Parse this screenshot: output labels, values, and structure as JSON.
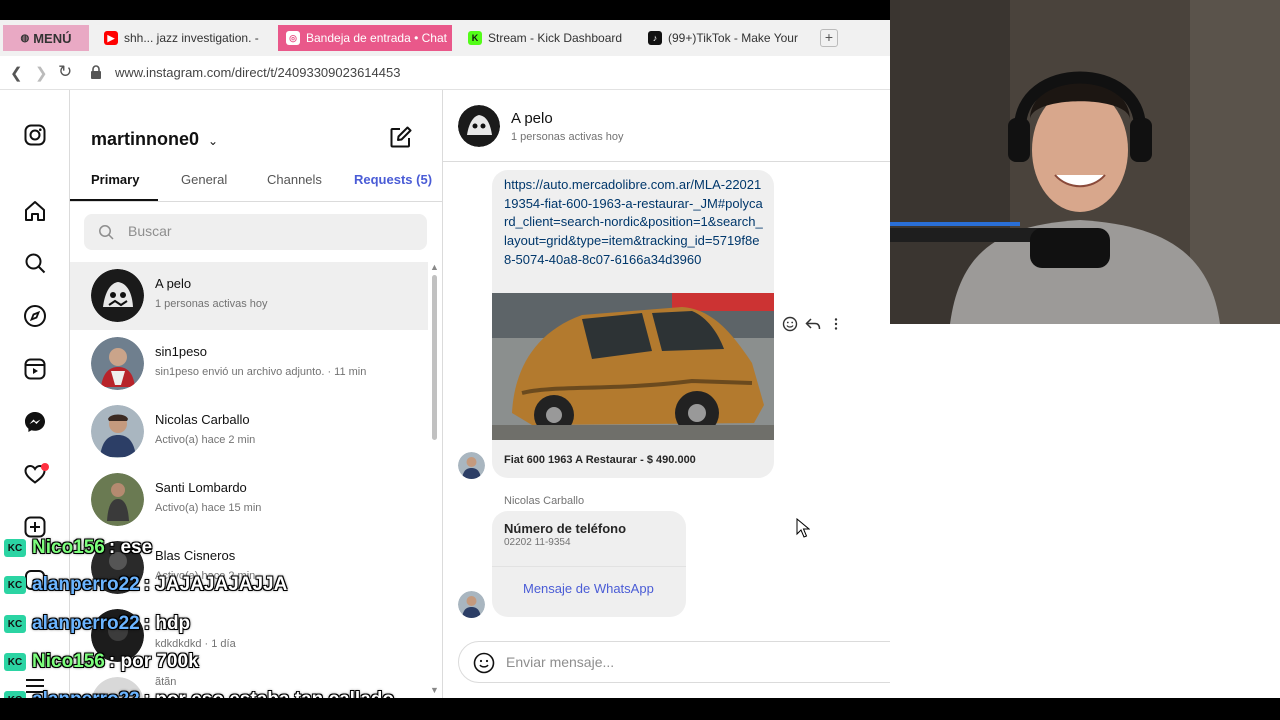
{
  "browser": {
    "menu_label": "MENÚ",
    "tabs": [
      {
        "label": "shh... jazz investigation. -",
        "icon": "youtube-icon",
        "color": "#ff0000"
      },
      {
        "label": "Bandeja de entrada • Chat",
        "icon": "instagram-icon",
        "color": "#e9588a"
      },
      {
        "label": "Stream - Kick Dashboard",
        "icon": "kick-icon",
        "color": "#53fc18"
      },
      {
        "label": "(99+)TikTok - Make Your",
        "icon": "tiktok-icon",
        "color": "#111111"
      }
    ],
    "new_tab": "+",
    "url": "www.instagram.com/direct/t/24093309023614453"
  },
  "instagram": {
    "username": "martinnone0",
    "tabs": [
      "Primary",
      "General",
      "Channels",
      "Requests (5)"
    ],
    "search_placeholder": "Buscar",
    "conversations": [
      {
        "name": "A pelo",
        "sub": "1 personas activas hoy"
      },
      {
        "name": "sin1peso",
        "sub": "sin1peso envió un archivo adjunto. · 11 min"
      },
      {
        "name": "Nicolas Carballo",
        "sub": "Activo(a) hace 2 min"
      },
      {
        "name": "Santi Lombardo",
        "sub": "Activo(a) hace 15 min"
      },
      {
        "name": "Blas Cisneros",
        "sub": "Activo(a) hace 2 min"
      },
      {
        "name": "",
        "sub": "kdkdkdkd · 1 día"
      },
      {
        "name": "",
        "sub": "ãtãn"
      }
    ],
    "chat": {
      "name": "A pelo",
      "sub": "1 personas activas hoy",
      "link": "https://auto.mercadolibre.com.ar/MLA-2202119354-fiat-600-1963-a-restaurar-_JM#polycard_client=search-nordic&position=1&search_layout=grid&type=item&tracking_id=5719f8e8-5074-40a8-8c07-6166a34d3960",
      "link_caption": "Fiat 600 1963 A Restaurar - $ 490.000",
      "sender": "Nicolas Carballo",
      "contact_title": "Número de teléfono",
      "contact_number": "02202 11-9354",
      "whatsapp_label": "Mensaje de WhatsApp",
      "composer_placeholder": "Enviar mensaje..."
    }
  },
  "stream_chat": [
    {
      "user": "Nico156",
      "text": ": ese",
      "badge": "KC"
    },
    {
      "user": "alanperro22",
      "text": ": JAJAJAJAJJA",
      "badge": "KC"
    },
    {
      "user": "alanperro22",
      "text": ": hdp",
      "badge": "KC"
    },
    {
      "user": "Nico156",
      "text": ": por 700k",
      "badge": "KC"
    },
    {
      "user": "alanperro22",
      "text": ": por eso estaba tan callado",
      "badge": "KC"
    }
  ]
}
